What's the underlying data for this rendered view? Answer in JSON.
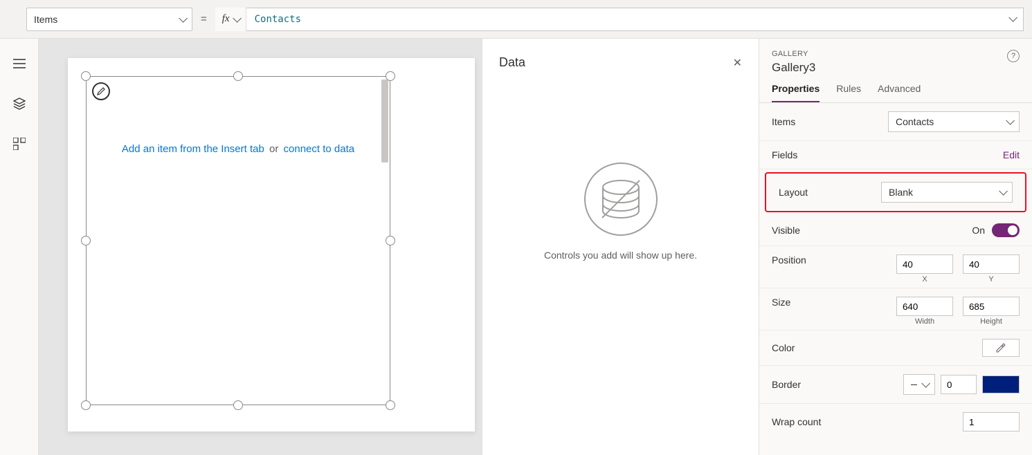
{
  "formula_bar": {
    "property": "Items",
    "equals": "=",
    "fx": "fx",
    "value": "Contacts"
  },
  "canvas": {
    "placeholder_prefix": "Add an item from the Insert tab",
    "placeholder_or": "or",
    "placeholder_link": "connect to data"
  },
  "data_panel": {
    "title": "Data",
    "empty_text": "Controls you add will show up here."
  },
  "props": {
    "eyebrow": "GALLERY",
    "name": "Gallery3",
    "tabs": {
      "properties": "Properties",
      "rules": "Rules",
      "advanced": "Advanced"
    },
    "items": {
      "label": "Items",
      "value": "Contacts"
    },
    "fields": {
      "label": "Fields",
      "edit": "Edit"
    },
    "layout": {
      "label": "Layout",
      "value": "Blank"
    },
    "visible": {
      "label": "Visible",
      "state": "On"
    },
    "position": {
      "label": "Position",
      "x": "40",
      "y": "40",
      "xlabel": "X",
      "ylabel": "Y"
    },
    "size": {
      "label": "Size",
      "w": "640",
      "h": "685",
      "wlabel": "Width",
      "hlabel": "Height"
    },
    "color": {
      "label": "Color"
    },
    "border": {
      "label": "Border",
      "value": "0"
    },
    "wrap": {
      "label": "Wrap count",
      "value": "1"
    }
  }
}
